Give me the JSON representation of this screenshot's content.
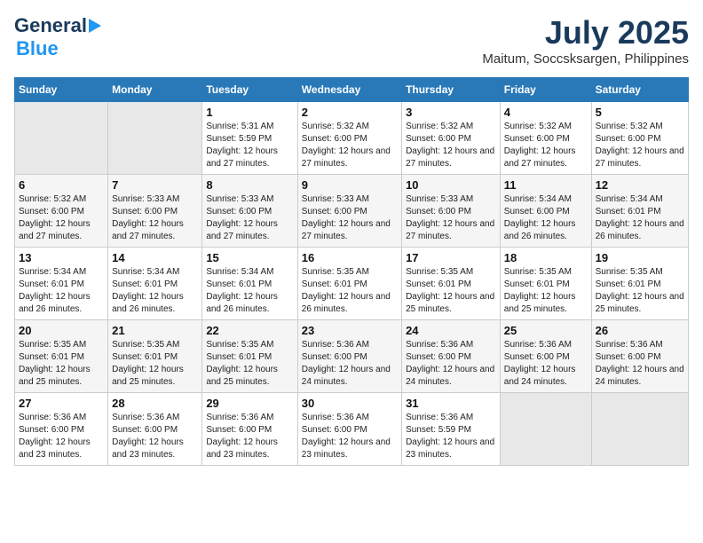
{
  "logo": {
    "line1": "General",
    "line2": "Blue"
  },
  "title": "July 2025",
  "subtitle": "Maitum, Soccsksargen, Philippines",
  "days_of_week": [
    "Sunday",
    "Monday",
    "Tuesday",
    "Wednesday",
    "Thursday",
    "Friday",
    "Saturday"
  ],
  "weeks": [
    [
      {
        "day": "",
        "info": ""
      },
      {
        "day": "",
        "info": ""
      },
      {
        "day": "1",
        "info": "Sunrise: 5:31 AM\nSunset: 5:59 PM\nDaylight: 12 hours and 27 minutes."
      },
      {
        "day": "2",
        "info": "Sunrise: 5:32 AM\nSunset: 6:00 PM\nDaylight: 12 hours and 27 minutes."
      },
      {
        "day": "3",
        "info": "Sunrise: 5:32 AM\nSunset: 6:00 PM\nDaylight: 12 hours and 27 minutes."
      },
      {
        "day": "4",
        "info": "Sunrise: 5:32 AM\nSunset: 6:00 PM\nDaylight: 12 hours and 27 minutes."
      },
      {
        "day": "5",
        "info": "Sunrise: 5:32 AM\nSunset: 6:00 PM\nDaylight: 12 hours and 27 minutes."
      }
    ],
    [
      {
        "day": "6",
        "info": "Sunrise: 5:32 AM\nSunset: 6:00 PM\nDaylight: 12 hours and 27 minutes."
      },
      {
        "day": "7",
        "info": "Sunrise: 5:33 AM\nSunset: 6:00 PM\nDaylight: 12 hours and 27 minutes."
      },
      {
        "day": "8",
        "info": "Sunrise: 5:33 AM\nSunset: 6:00 PM\nDaylight: 12 hours and 27 minutes."
      },
      {
        "day": "9",
        "info": "Sunrise: 5:33 AM\nSunset: 6:00 PM\nDaylight: 12 hours and 27 minutes."
      },
      {
        "day": "10",
        "info": "Sunrise: 5:33 AM\nSunset: 6:00 PM\nDaylight: 12 hours and 27 minutes."
      },
      {
        "day": "11",
        "info": "Sunrise: 5:34 AM\nSunset: 6:00 PM\nDaylight: 12 hours and 26 minutes."
      },
      {
        "day": "12",
        "info": "Sunrise: 5:34 AM\nSunset: 6:01 PM\nDaylight: 12 hours and 26 minutes."
      }
    ],
    [
      {
        "day": "13",
        "info": "Sunrise: 5:34 AM\nSunset: 6:01 PM\nDaylight: 12 hours and 26 minutes."
      },
      {
        "day": "14",
        "info": "Sunrise: 5:34 AM\nSunset: 6:01 PM\nDaylight: 12 hours and 26 minutes."
      },
      {
        "day": "15",
        "info": "Sunrise: 5:34 AM\nSunset: 6:01 PM\nDaylight: 12 hours and 26 minutes."
      },
      {
        "day": "16",
        "info": "Sunrise: 5:35 AM\nSunset: 6:01 PM\nDaylight: 12 hours and 26 minutes."
      },
      {
        "day": "17",
        "info": "Sunrise: 5:35 AM\nSunset: 6:01 PM\nDaylight: 12 hours and 25 minutes."
      },
      {
        "day": "18",
        "info": "Sunrise: 5:35 AM\nSunset: 6:01 PM\nDaylight: 12 hours and 25 minutes."
      },
      {
        "day": "19",
        "info": "Sunrise: 5:35 AM\nSunset: 6:01 PM\nDaylight: 12 hours and 25 minutes."
      }
    ],
    [
      {
        "day": "20",
        "info": "Sunrise: 5:35 AM\nSunset: 6:01 PM\nDaylight: 12 hours and 25 minutes."
      },
      {
        "day": "21",
        "info": "Sunrise: 5:35 AM\nSunset: 6:01 PM\nDaylight: 12 hours and 25 minutes."
      },
      {
        "day": "22",
        "info": "Sunrise: 5:35 AM\nSunset: 6:01 PM\nDaylight: 12 hours and 25 minutes."
      },
      {
        "day": "23",
        "info": "Sunrise: 5:36 AM\nSunset: 6:00 PM\nDaylight: 12 hours and 24 minutes."
      },
      {
        "day": "24",
        "info": "Sunrise: 5:36 AM\nSunset: 6:00 PM\nDaylight: 12 hours and 24 minutes."
      },
      {
        "day": "25",
        "info": "Sunrise: 5:36 AM\nSunset: 6:00 PM\nDaylight: 12 hours and 24 minutes."
      },
      {
        "day": "26",
        "info": "Sunrise: 5:36 AM\nSunset: 6:00 PM\nDaylight: 12 hours and 24 minutes."
      }
    ],
    [
      {
        "day": "27",
        "info": "Sunrise: 5:36 AM\nSunset: 6:00 PM\nDaylight: 12 hours and 23 minutes."
      },
      {
        "day": "28",
        "info": "Sunrise: 5:36 AM\nSunset: 6:00 PM\nDaylight: 12 hours and 23 minutes."
      },
      {
        "day": "29",
        "info": "Sunrise: 5:36 AM\nSunset: 6:00 PM\nDaylight: 12 hours and 23 minutes."
      },
      {
        "day": "30",
        "info": "Sunrise: 5:36 AM\nSunset: 6:00 PM\nDaylight: 12 hours and 23 minutes."
      },
      {
        "day": "31",
        "info": "Sunrise: 5:36 AM\nSunset: 5:59 PM\nDaylight: 12 hours and 23 minutes."
      },
      {
        "day": "",
        "info": ""
      },
      {
        "day": "",
        "info": ""
      }
    ]
  ]
}
